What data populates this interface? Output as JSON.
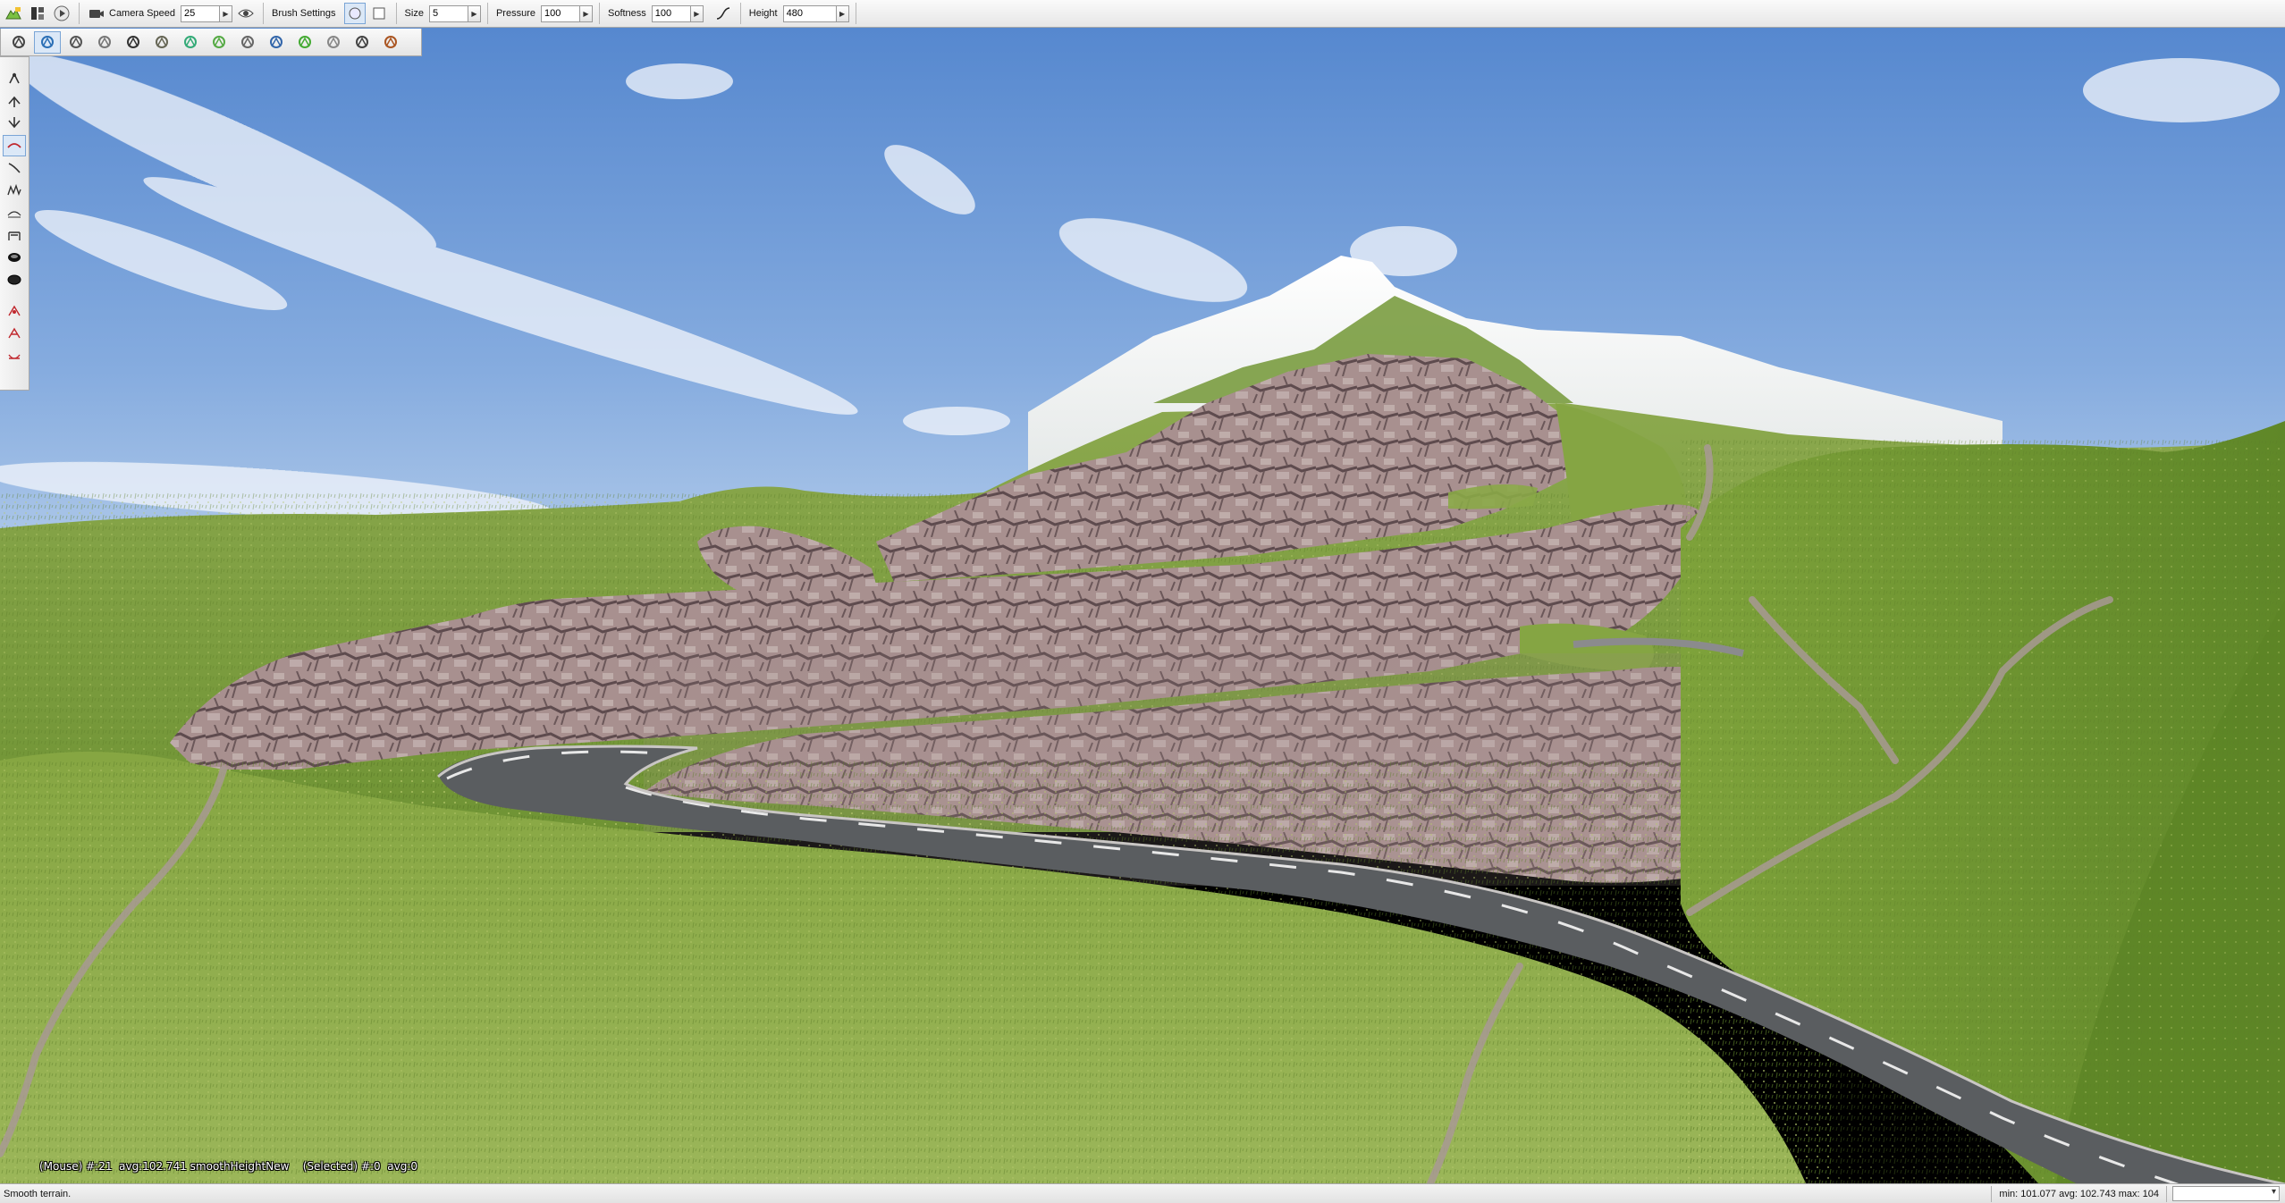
{
  "toolbar": {
    "icons": [
      "terrain-editor-icon",
      "layout-icon",
      "play-icon"
    ],
    "camera_icon": "camera-icon",
    "camera_speed_label": "Camera Speed",
    "camera_speed_value": "25",
    "visibility_icon": "eye-icon",
    "brush_settings_label": "Brush Settings",
    "brush_shapes": [
      "circle-brush-icon",
      "square-brush-icon"
    ],
    "size_label": "Size",
    "size_value": "5",
    "pressure_label": "Pressure",
    "pressure_value": "100",
    "softness_label": "Softness",
    "softness_value": "100",
    "falloff_icon": "falloff-curve-icon",
    "height_label": "Height",
    "height_value": "480"
  },
  "tool_row": {
    "tools": [
      "select-tool-icon",
      "terrain-tool-icon",
      "road-tool-icon",
      "material-tool-icon",
      "mesh-tool-icon",
      "building-tool-icon",
      "object-tool-icon",
      "paint-tool-icon",
      "decal-tool-icon",
      "river-tool-icon",
      "forest-tool-icon",
      "wind-tool-icon",
      "node-tool-icon",
      "particle-tool-icon"
    ],
    "active_index": 1
  },
  "left_palette": {
    "tools": [
      "raise-lower-icon",
      "raise-icon",
      "lower-icon",
      "smooth-icon",
      "slope-icon",
      "noise-icon",
      "flatten-icon",
      "set-height-icon",
      "hole-icon",
      "fill-icon",
      "gap",
      "erode-icon",
      "lift-icon",
      "level-icon"
    ],
    "active_index": 3
  },
  "hud": {
    "text": "(Mouse) #:21  avg:102.741 smoothHeightNew    (Selected) #:0  avg:0"
  },
  "status_bar": {
    "message": "Smooth terrain.",
    "stats": "min: 101.077  avg: 102.743  max: 104",
    "selector_value": ""
  },
  "colors": {
    "sky_top": "#5b8fd3",
    "sky_bottom": "#b9d2ef",
    "grass": "#7f9e3f",
    "rock": "#a08a8a",
    "snow": "#f1f3f2",
    "road": "#5a5d60"
  }
}
